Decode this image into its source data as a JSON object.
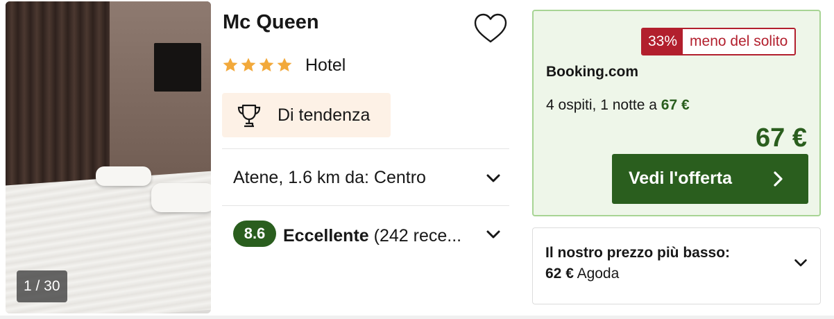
{
  "listing": {
    "title": "Mc Queen",
    "star_count": 4,
    "star_color": "#f2a93b",
    "type": "Hotel",
    "photo_counter": "1 / 30",
    "trend_label": "Di tendenza",
    "location": "Atene, 1.6 km da: Centro",
    "rating": {
      "score": "8.6",
      "label": "Eccellente",
      "reviews": "(242 rece..."
    }
  },
  "offer": {
    "discount_pct": "33%",
    "discount_text": "meno del solito",
    "provider": "Booking.com",
    "guests_text": "4 ospiti, 1 notte a ",
    "guests_price": "67 €",
    "price": "67 €",
    "cta_label": "Vedi l'offerta"
  },
  "lowest_price": {
    "label": "Il nostro prezzo più basso:",
    "price": "62 €",
    "provider": "Agoda"
  },
  "colors": {
    "accent_green": "#2a5e1e",
    "badge_red": "#b21f2d",
    "offer_bg": "#eef6e9",
    "trend_bg": "#fdf1e6"
  },
  "icons": [
    "heart-icon",
    "star-icon",
    "trophy-icon",
    "chevron-down-icon",
    "chevron-right-icon"
  ]
}
